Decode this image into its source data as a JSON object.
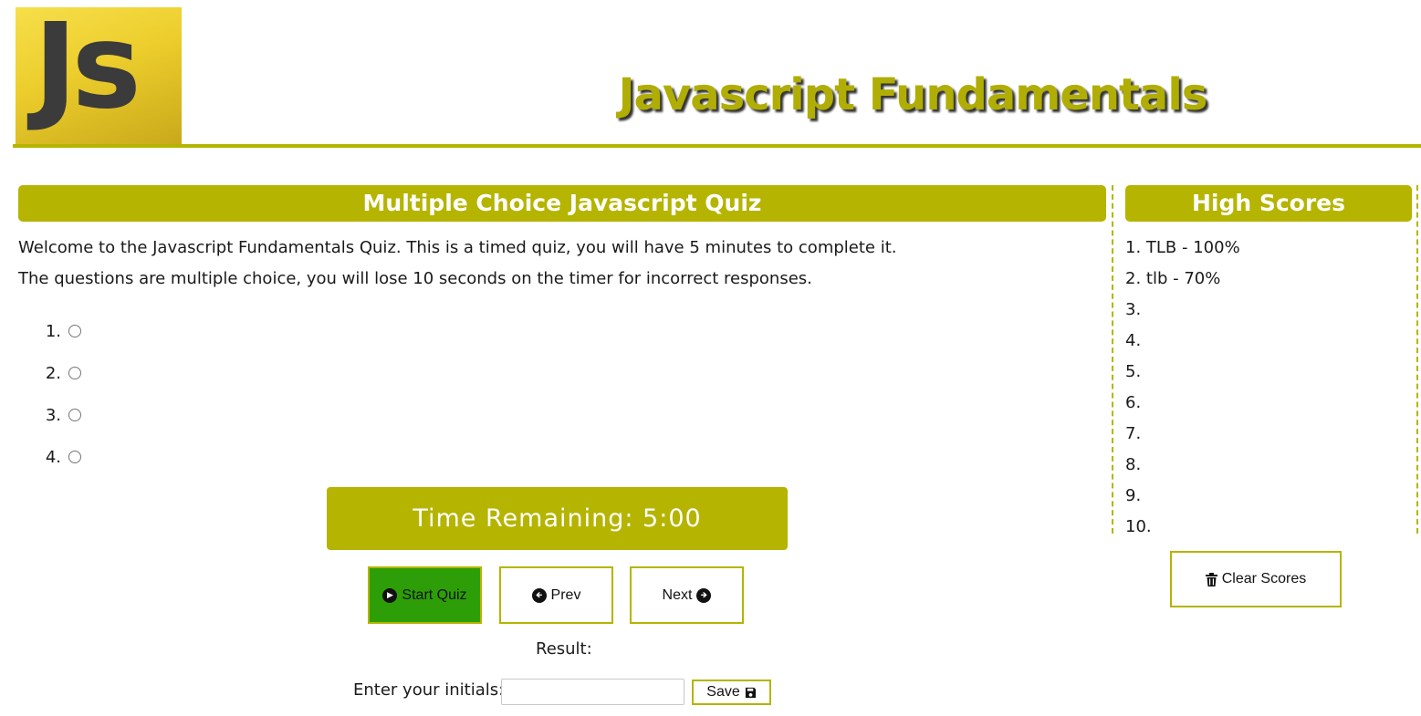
{
  "header": {
    "logo_text": "Js",
    "title": "Javascript Fundamentals"
  },
  "quiz": {
    "heading": "Multiple Choice Javascript Quiz",
    "intro_line1": "Welcome to the Javascript Fundamentals Quiz. This is a timed quiz, you will have 5 minutes to complete it.",
    "intro_line2": "The questions are multiple choice, you will lose 10 seconds on the timer for incorrect responses.",
    "choices": [
      {
        "num": "1.",
        "label": ""
      },
      {
        "num": "2.",
        "label": ""
      },
      {
        "num": "3.",
        "label": ""
      },
      {
        "num": "4.",
        "label": ""
      }
    ],
    "timer": "Time Remaining: 5:00",
    "start_label": "Start Quiz",
    "prev_label": "Prev",
    "next_label": "Next",
    "result_label": "Result:",
    "initials_label": "Enter your initials:",
    "initials_value": "",
    "save_label": "Save"
  },
  "scores": {
    "heading": "High Scores",
    "items": [
      "1. TLB - 100%",
      "2. tlb - 70%",
      "3.",
      "4.",
      "5.",
      "6.",
      "7.",
      "8.",
      "9.",
      "10."
    ],
    "clear_label": "Clear Scores"
  },
  "colors": {
    "accent": "#b5b400",
    "start_button": "#2d9e07",
    "logo_yellow": "#f0d531"
  },
  "icons": {
    "start": "play-circle-icon",
    "prev": "arrow-circle-left-icon",
    "next": "arrow-circle-right-icon",
    "save": "floppy-disk-icon",
    "clear": "trash-icon"
  }
}
